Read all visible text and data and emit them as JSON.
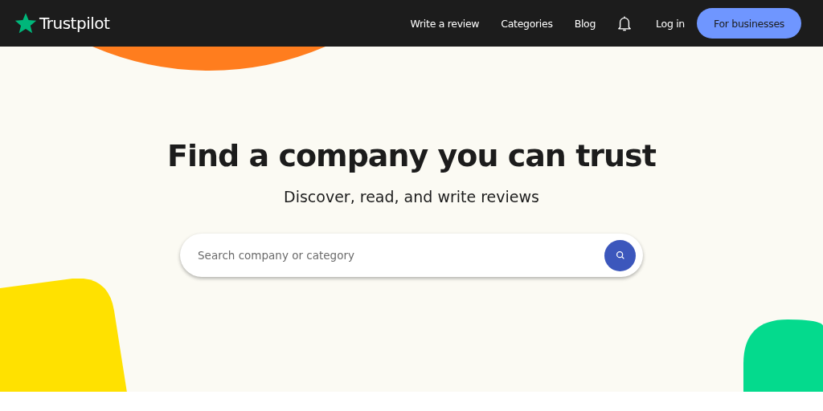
{
  "header": {
    "logo": "Trustpilot",
    "nav": [
      {
        "label": "Write a review"
      },
      {
        "label": "Categories"
      },
      {
        "label": "Blog"
      }
    ],
    "login": "Log in",
    "cta": "For businesses"
  },
  "hero": {
    "title": "Find a company you can trust",
    "subtitle": "Discover, read, and write reviews",
    "search": {
      "placeholder": "Search company or category"
    }
  }
}
